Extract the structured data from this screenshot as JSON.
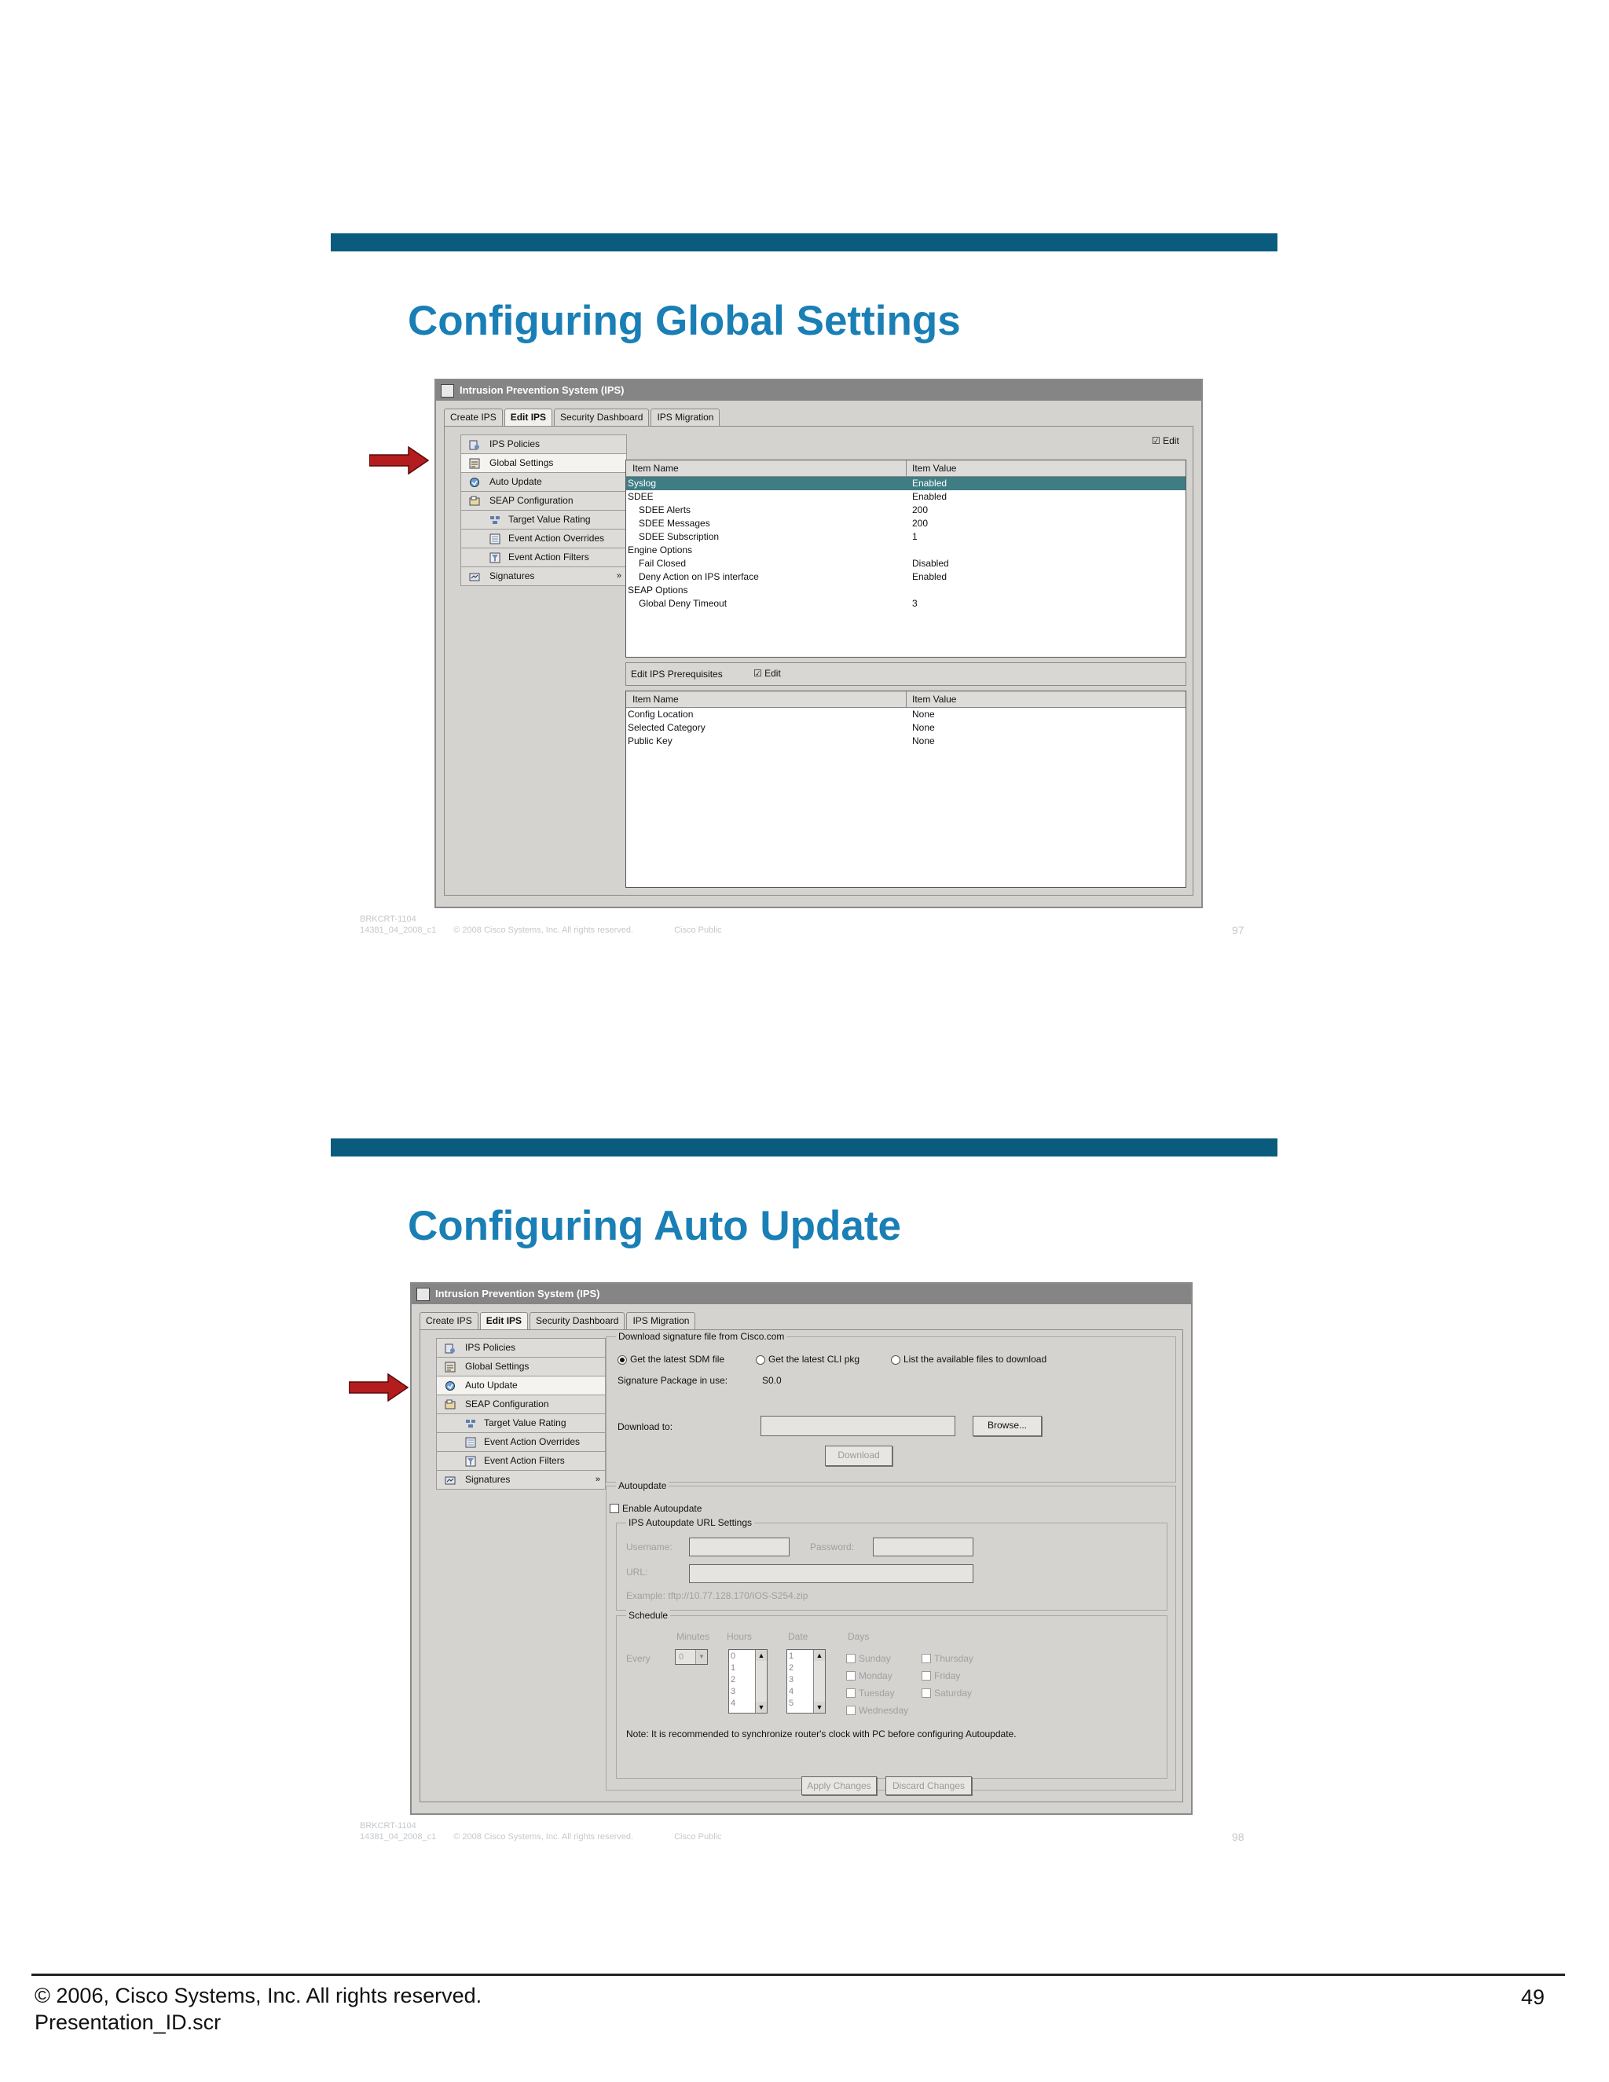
{
  "slide1": {
    "title": "Configuring Global Settings",
    "footer_id": "BRKCRT-1104",
    "footer_doc": "14381_04_2008_c1",
    "footer_copyright": "© 2008 Cisco Systems, Inc. All rights reserved.",
    "footer_class": "Cisco Public",
    "page": "97",
    "window": {
      "title": "Intrusion Prevention System (IPS)",
      "tabs": [
        "Create IPS",
        "Edit IPS",
        "Security Dashboard",
        "IPS Migration"
      ],
      "nav": [
        {
          "label": "IPS Policies",
          "icon": "policy-icon"
        },
        {
          "label": "Global Settings",
          "icon": "settings-icon"
        },
        {
          "label": "Auto Update",
          "icon": "update-icon"
        },
        {
          "label": "SEAP Configuration",
          "icon": "seap-icon"
        },
        {
          "label": "Target Value Rating",
          "icon": "target-icon"
        },
        {
          "label": "Event Action Overrides",
          "icon": "override-icon"
        },
        {
          "label": "Event Action Filters",
          "icon": "filter-icon"
        },
        {
          "label": "Signatures",
          "icon": "signature-icon"
        }
      ],
      "edit_label": "Edit",
      "col_name": "Item Name",
      "col_value": "Item Value",
      "rows": [
        {
          "name": "Syslog",
          "value": "Enabled",
          "indent": 0,
          "selected": true
        },
        {
          "name": "SDEE",
          "value": "Enabled",
          "indent": 0
        },
        {
          "name": "SDEE Alerts",
          "value": "200",
          "indent": 1
        },
        {
          "name": "SDEE Messages",
          "value": "200",
          "indent": 1
        },
        {
          "name": "SDEE Subscription",
          "value": "1",
          "indent": 1
        },
        {
          "name": "Engine Options",
          "value": "",
          "indent": 0
        },
        {
          "name": "Fail Closed",
          "value": "Disabled",
          "indent": 1
        },
        {
          "name": "Deny Action on IPS interface",
          "value": "Enabled",
          "indent": 1
        },
        {
          "name": "SEAP Options",
          "value": "",
          "indent": 0
        },
        {
          "name": "Global Deny Timeout",
          "value": "3",
          "indent": 1
        }
      ],
      "prereq_label": "Edit IPS Prerequisites",
      "prereq_edit": "Edit",
      "prereq_rows": [
        {
          "name": "Config Location",
          "value": "None"
        },
        {
          "name": "Selected Category",
          "value": "None"
        },
        {
          "name": "Public Key",
          "value": "None"
        }
      ]
    }
  },
  "slide2": {
    "title": "Configuring Auto Update",
    "footer_id": "BRKCRT-1104",
    "footer_doc": "14381_04_2008_c1",
    "footer_copyright": "© 2008 Cisco Systems, Inc. All rights reserved.",
    "footer_class": "Cisco Public",
    "page": "98",
    "window": {
      "title": "Intrusion Prevention System (IPS)",
      "tabs": [
        "Create IPS",
        "Edit IPS",
        "Security Dashboard",
        "IPS Migration"
      ],
      "nav": [
        {
          "label": "IPS Policies",
          "icon": "policy-icon"
        },
        {
          "label": "Global Settings",
          "icon": "settings-icon"
        },
        {
          "label": "Auto Update",
          "icon": "update-icon"
        },
        {
          "label": "SEAP Configuration",
          "icon": "seap-icon"
        },
        {
          "label": "Target Value Rating",
          "icon": "target-icon"
        },
        {
          "label": "Event Action Overrides",
          "icon": "override-icon"
        },
        {
          "label": "Event Action Filters",
          "icon": "filter-icon"
        },
        {
          "label": "Signatures",
          "icon": "signature-icon"
        }
      ],
      "download_group": "Download signature file from Cisco.com",
      "radio_sdm": "Get the latest SDM file",
      "radio_cli": "Get the latest CLI pkg",
      "radio_list": "List the available files to download",
      "sig_pkg_label": "Signature Package in use:",
      "sig_pkg_value": "S0.0",
      "download_to_label": "Download to:",
      "browse_button": "Browse...",
      "download_button": "Download",
      "autoupdate_group": "Autoupdate",
      "enable_autoupdate": "Enable Autoupdate",
      "url_settings_group": "IPS Autoupdate URL Settings",
      "username_label": "Username:",
      "password_label": "Password:",
      "url_label": "URL:",
      "example": "Example: tftp://10.77.128.170/IOS-S254.zip",
      "schedule_group": "Schedule",
      "minutes_label": "Minutes",
      "hours_label": "Hours",
      "date_label": "Date",
      "days_label": "Days",
      "every_label": "Every",
      "minutes_value": "0",
      "hours_list": [
        "0",
        "1",
        "2",
        "3",
        "4"
      ],
      "date_list": [
        "1",
        "2",
        "3",
        "4",
        "5"
      ],
      "days": [
        "Sunday",
        "Monday",
        "Tuesday",
        "Wednesday",
        "Thursday",
        "Friday",
        "Saturday"
      ],
      "note": "Note: It is recommended to synchronize router's clock with PC before configuring Autoupdate.",
      "apply_button": "Apply Changes",
      "discard_button": "Discard Changes"
    }
  },
  "page_footer": {
    "copyright": "© 2006, Cisco Systems, Inc. All rights reserved.",
    "presentation_id": "Presentation_ID.scr",
    "page_number": "49"
  },
  "colors": {
    "slide_bar": "#0b5b7f",
    "title": "#1a7fb5",
    "arrow": "#b41d1d",
    "selected_row": "#3f7d85"
  }
}
